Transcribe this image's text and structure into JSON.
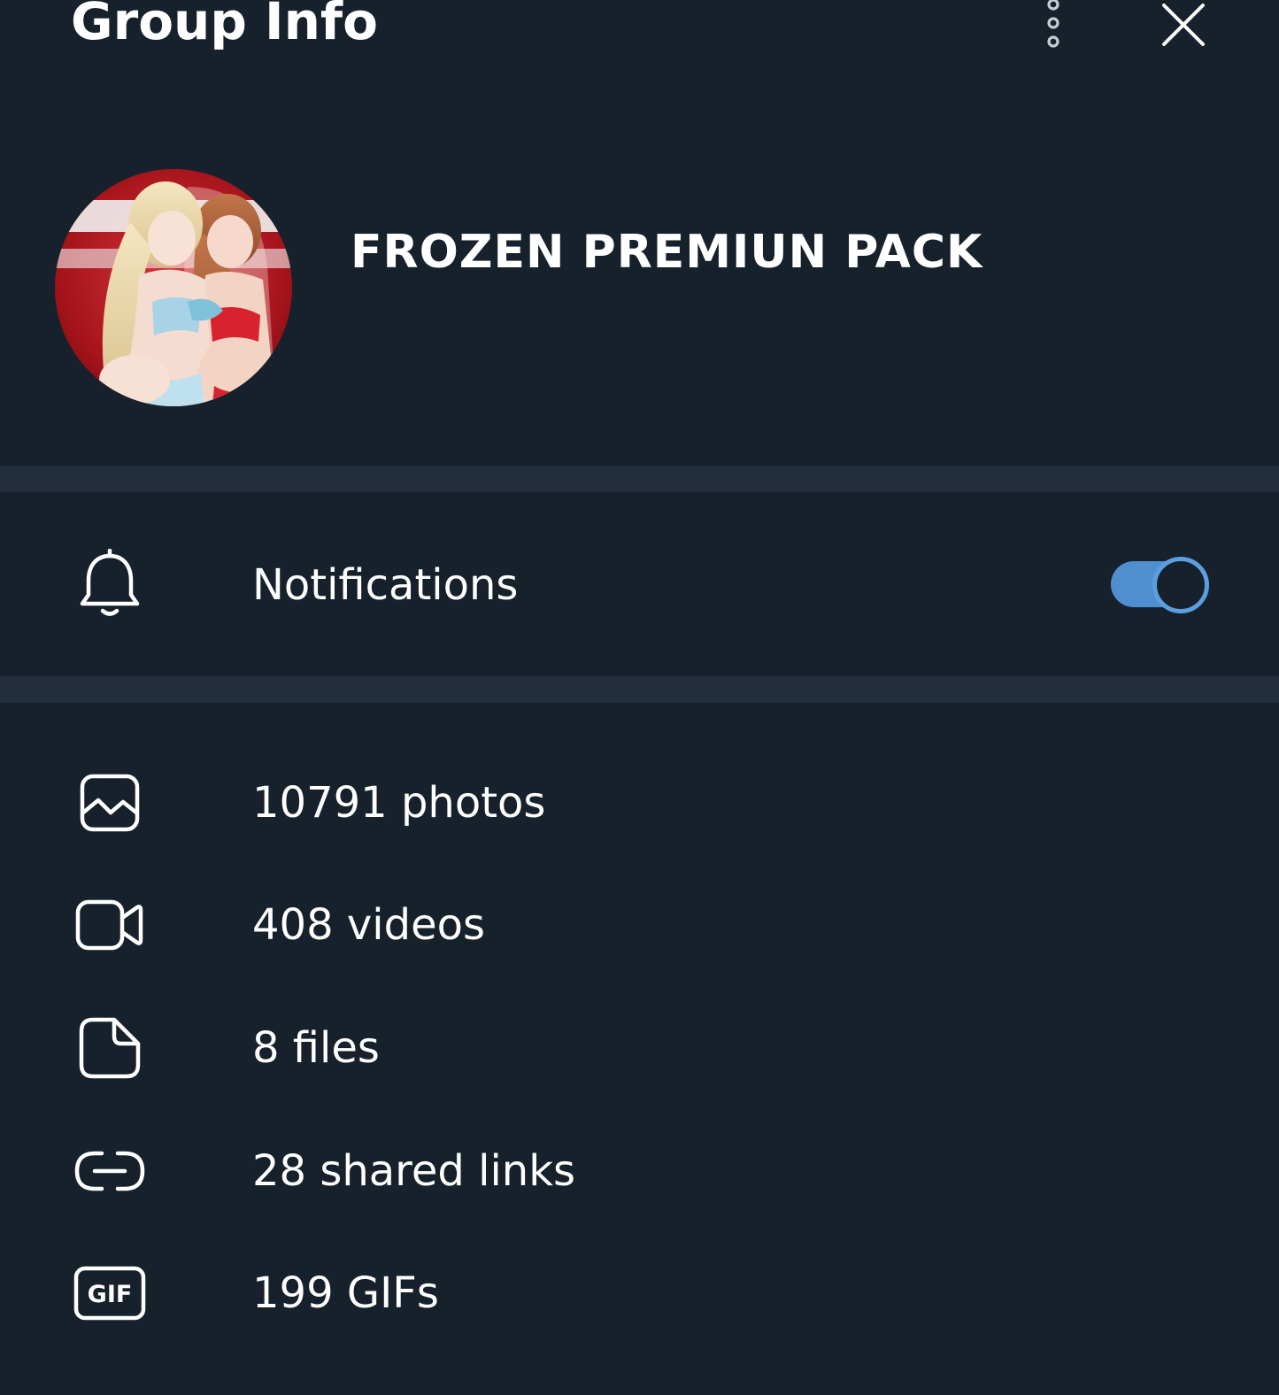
{
  "header": {
    "title": "Group Info"
  },
  "profile": {
    "group_name": "FROZEN PREMIUN PACK"
  },
  "notifications": {
    "label": "Notifications",
    "enabled": true
  },
  "media": [
    {
      "label": "10791 photos",
      "icon": "photo-icon"
    },
    {
      "label": "408 videos",
      "icon": "video-icon"
    },
    {
      "label": "8 files",
      "icon": "file-icon"
    },
    {
      "label": "28 shared links",
      "icon": "link-icon"
    },
    {
      "label": "199 GIFs",
      "icon": "gif-icon"
    }
  ],
  "gif_icon_text": "GIF",
  "colors": {
    "background": "#17212b",
    "divider": "#232e3c",
    "accent": "#5c9fe0",
    "text": "#ffffff"
  }
}
